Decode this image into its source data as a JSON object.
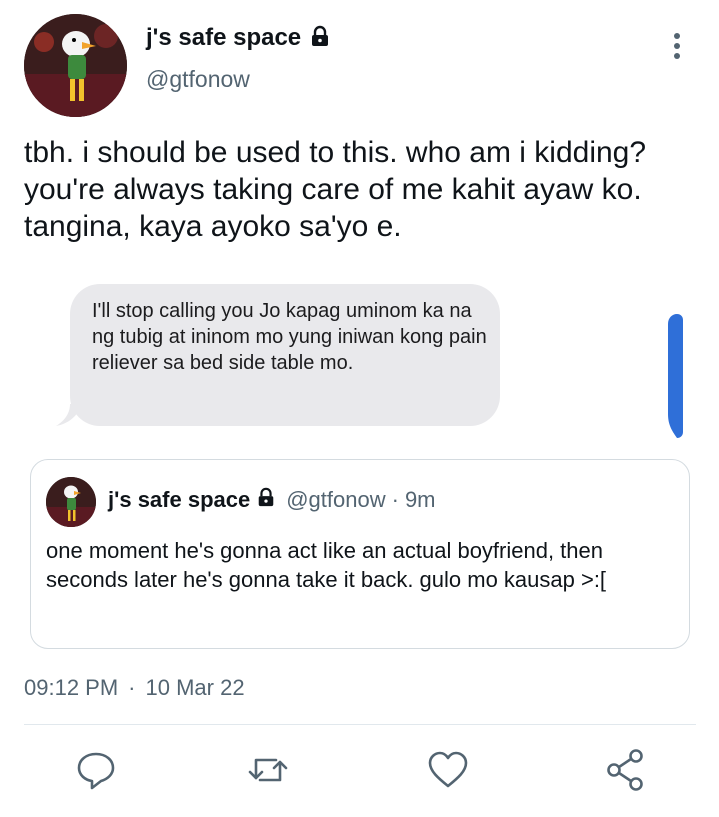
{
  "tweet": {
    "display_name": "j's safe space",
    "handle": "@gtfonow",
    "text": "tbh. i should be used to this. who am i kidding? you're always taking care of me kahit ayaw ko. tangina, kaya ayoko sa'yo e.",
    "attached_message": "I'll stop calling you Jo kapag uminom ka na ng tubig at ininom mo yung iniwan kong pain reliever sa bed side table mo.",
    "time": "09:12 PM",
    "separator": "·",
    "date": "10 Mar 22"
  },
  "quote": {
    "display_name": "j's safe space",
    "handle": "@gtfonow",
    "separator": "·",
    "time_ago": "9m",
    "text": "one moment he's gonna act like an actual boyfriend, then seconds later he's gonna take it back. gulo mo kausap >:["
  },
  "icons": {
    "lock": "lock-icon",
    "more": "more-vertical-icon",
    "reply": "reply-icon",
    "retweet": "retweet-icon",
    "like": "heart-icon",
    "share": "share-icon"
  },
  "colors": {
    "text": "#0f1419",
    "secondary": "#536471",
    "bubble": "#e9e9ec",
    "scroll_thumb": "#2f6fd8",
    "border": "#d4dbe0"
  }
}
